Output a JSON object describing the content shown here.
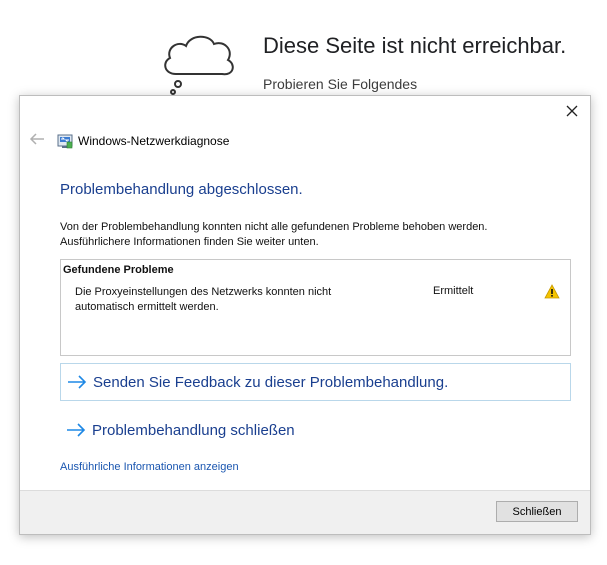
{
  "background_page": {
    "title": "Diese Seite ist nicht erreichbar.",
    "subtitle": "Probieren Sie Folgendes"
  },
  "dialog": {
    "window_title": "Windows-Netzwerkdiagnose",
    "heading": "Problembehandlung abgeschlossen.",
    "description": "Von der Problembehandlung konnten nicht alle gefundenen Probleme behoben werden. Ausführlichere Informationen finden Sie weiter unten.",
    "problems": {
      "header": "Gefundene Probleme",
      "items": [
        {
          "text": "Die Proxyeinstellungen des Netzwerks konnten nicht automatisch ermittelt werden.",
          "status": "Ermittelt",
          "icon": "warning-icon"
        }
      ]
    },
    "feedback_link": "Senden Sie Feedback zu dieser Problembehandlung.",
    "close_link": "Problembehandlung schließen",
    "details_link": "Ausführliche Informationen anzeigen",
    "close_button": "Schließen"
  },
  "colors": {
    "heading": "#1a3f8f",
    "link": "#1a56b0",
    "arrow": "#1e88e5",
    "warning": "#f5c400"
  }
}
